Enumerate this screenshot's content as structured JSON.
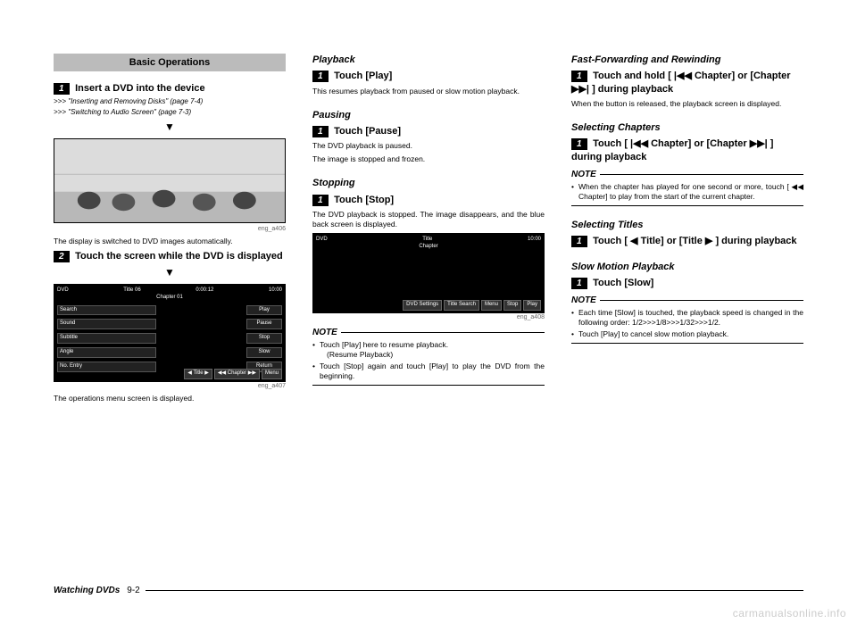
{
  "col1": {
    "section_header": "Basic Operations",
    "step1_num": "1",
    "step1_title": "Insert a DVD into the device",
    "ref1": ">>> \"Inserting and Removing Disks\" (page 7-4)",
    "ref2": ">>> \"Switching to Audio Screen\" (page 7-3)",
    "fig1_caption": "eng_a406",
    "body1": "The display is switched to DVD images automatically.",
    "step2_num": "2",
    "step2_title": "Touch the screen while the DVD is displayed",
    "fig2": {
      "bar_left": "DVD",
      "bar_title": "Title 06",
      "bar_time": "0:00:12",
      "bar_right": "10:00",
      "bar_chapter": "Chapter 01",
      "left_btns": [
        "Search",
        "Sound",
        "Subtitle",
        "Angle",
        "No. Entry"
      ],
      "right_btns": [
        "Play",
        "Pause",
        "Stop",
        "Slow",
        "Return"
      ],
      "bottom": [
        "◀ Title ▶",
        "◀◀ Chapter ▶▶",
        "Menu"
      ]
    },
    "fig2_caption": "eng_a407",
    "body2": "The operations menu screen is displayed."
  },
  "col2": {
    "h_playback": "Playback",
    "play_num": "1",
    "play_title": "Touch [Play]",
    "play_body": "This resumes playback from paused or slow motion playback.",
    "h_pausing": "Pausing",
    "pause_num": "1",
    "pause_title": "Touch [Pause]",
    "pause_body1": "The DVD playback is paused.",
    "pause_body2": "The image is stopped and frozen.",
    "h_stopping": "Stopping",
    "stop_num": "1",
    "stop_title": "Touch [Stop]",
    "stop_body": "The DVD playback is stopped. The image disappears, and the blue back screen is displayed.",
    "fig3": {
      "bar_left": "DVD",
      "bar_title": "Title",
      "bar_right": "10:00",
      "bar_chapter": "Chapter",
      "bottom": [
        "DVD Settings",
        "Title Search",
        "Menu",
        "Stop",
        "Play"
      ]
    },
    "fig3_caption": "eng_a408",
    "note_label": "NOTE",
    "note1": "Touch [Play] here to resume playback.",
    "note1b": "(Resume Playback)",
    "note2": "Touch [Stop] again and touch [Play] to play the DVD from the beginning."
  },
  "col3": {
    "h_ff": "Fast-Forwarding and Rewinding",
    "ff_num": "1",
    "ff_title_a": "Touch and hold [",
    "ff_title_b": "Chapter] or [Chapter",
    "ff_title_c": "] during playback",
    "ff_body": "When the button is released, the playback screen is displayed.",
    "h_chapters": "Selecting Chapters",
    "ch_num": "1",
    "ch_title_a": "Touch [",
    "ch_title_b": "Chapter] or [Chapter",
    "ch_title_c": "] during playback",
    "note_label": "NOTE",
    "ch_note": "When the chapter has played for one second or more, touch [ ◀◀ Chapter] to play from the start of the current chapter.",
    "h_titles": "Selecting Titles",
    "ti_num": "1",
    "ti_title_a": "Touch [",
    "ti_title_b": "Title] or [Title",
    "ti_title_c": "] during playback",
    "h_slow": "Slow Motion Playback",
    "slow_num": "1",
    "slow_title": "Touch [Slow]",
    "slow_note1": "Each time [Slow] is touched, the playback speed is changed in the following order: 1/2>>>1/8>>>1/32>>>1/2.",
    "slow_note2": "Touch [Play] to cancel slow motion playback."
  },
  "footer": {
    "section": "Watching DVDs",
    "page": "9-2"
  },
  "watermark": "carmanualsonline.info",
  "glyphs": {
    "rev": "◀◀",
    "fwd": "▶▶",
    "left": "◀",
    "right": "▶",
    "skip_rev": "|◀◀",
    "skip_fwd": "▶▶|",
    "down": "▼"
  }
}
